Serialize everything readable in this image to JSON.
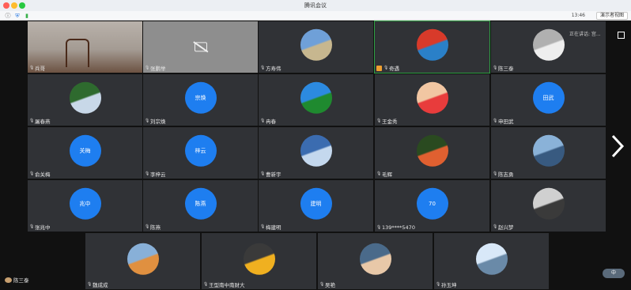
{
  "window": {
    "title": "腾讯会议"
  },
  "toolbar": {
    "time": "13:46",
    "button_label": "演示者视图"
  },
  "overlay": {
    "note": "正在讲话: 宫..."
  },
  "self": {
    "label": "陈三泰"
  },
  "control": {
    "label": "中"
  },
  "tiles": [
    {
      "name": "兵哥",
      "kind": "video"
    },
    {
      "name": "张鹏举",
      "kind": "camoff"
    },
    {
      "name": "方寿伟",
      "kind": "photo",
      "colors": [
        "#6fa0d8",
        "#c7b78f"
      ]
    },
    {
      "name": "奇遇",
      "kind": "photo",
      "colors": [
        "#d83a2a",
        "#2a80c8"
      ],
      "active": true,
      "host": true
    },
    {
      "name": "陈三泰",
      "kind": "photo",
      "colors": [
        "#b0b0b0",
        "#eeeeee"
      ]
    },
    {
      "name": "屠春燕",
      "kind": "photo",
      "colors": [
        "#2e6a2e",
        "#c8d8e8"
      ]
    },
    {
      "name": "刘宗焕",
      "kind": "circle",
      "circle": "宗焕"
    },
    {
      "name": "冉春",
      "kind": "photo",
      "colors": [
        "#2c8ae0",
        "#1f8a2f"
      ]
    },
    {
      "name": "王金秀",
      "kind": "photo",
      "colors": [
        "#f1c6a2",
        "#e83c3c"
      ]
    },
    {
      "name": "申田武",
      "kind": "circle",
      "circle": "田武"
    },
    {
      "name": "俞关梅",
      "kind": "circle",
      "circle": "关梅"
    },
    {
      "name": "李梓云",
      "kind": "circle",
      "circle": "梓云"
    },
    {
      "name": "曹新宇",
      "kind": "photo",
      "colors": [
        "#3b6cb0",
        "#c4d8ee"
      ]
    },
    {
      "name": "毛辉",
      "kind": "photo",
      "colors": [
        "#2a4a20",
        "#e06030"
      ]
    },
    {
      "name": "陈志勇",
      "kind": "photo",
      "colors": [
        "#8ab2d8",
        "#385a80"
      ]
    },
    {
      "name": "张兆中",
      "kind": "circle",
      "circle": "兆中"
    },
    {
      "name": "陈燕",
      "kind": "circle",
      "circle": "陈燕"
    },
    {
      "name": "梅建明",
      "kind": "circle",
      "circle": "建明"
    },
    {
      "name": "139****5470",
      "kind": "circle",
      "circle": "70"
    },
    {
      "name": "赵兴梦",
      "kind": "photo",
      "colors": [
        "#d0d0d0",
        "#3a3a3a"
      ]
    },
    {
      "name": "魏成成",
      "kind": "photo",
      "colors": [
        "#88b0d8",
        "#e09040"
      ]
    },
    {
      "name": "王型南中南财大",
      "kind": "photo",
      "colors": [
        "#3a3a3a",
        "#f0b020"
      ]
    },
    {
      "name": "吴艳",
      "kind": "photo",
      "colors": [
        "#4a6a8a",
        "#e8c8a8"
      ]
    },
    {
      "name": "孙玉坤",
      "kind": "photo",
      "colors": [
        "#d8e8f8",
        "#6a8aa8"
      ]
    }
  ]
}
